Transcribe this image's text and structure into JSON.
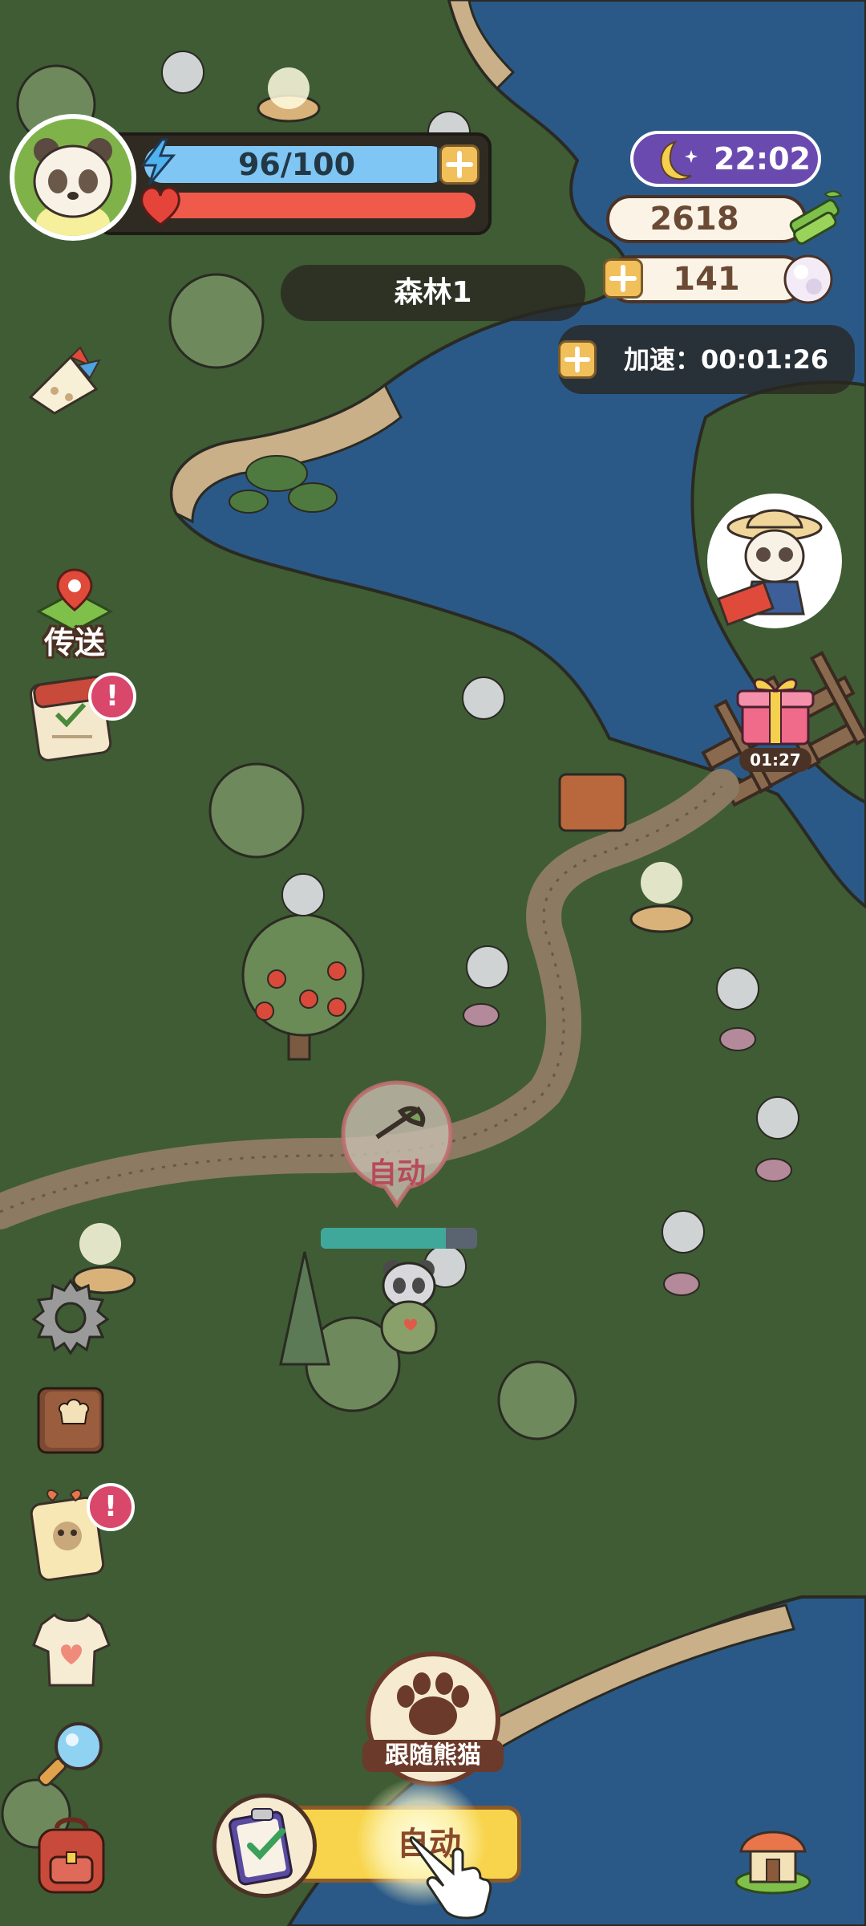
{
  "hud": {
    "energy_text": "96/100",
    "energy_fraction": 0.96,
    "health_fraction": 1.0,
    "location": "森林1",
    "time": "22:02",
    "bamboo": "2618",
    "pearls": "141",
    "speed_label": "加速：00:01:26"
  },
  "side_menu": {
    "teleport_label": "传送"
  },
  "gift": {
    "timer": "01:27"
  },
  "center": {
    "auto_label": "自动",
    "progress_fraction": 0.8
  },
  "bottom": {
    "follow_label": "跟随熊猫",
    "action_label": "自动"
  },
  "badges": {
    "alert": "!"
  },
  "colors": {
    "grass": "#3d5a34",
    "water": "#2c5b8c",
    "path": "#8c7a63",
    "energy": "#7fc6f4",
    "health": "#ef5a4b",
    "moon_pill": "#6b4ab0",
    "badge": "#d9476a",
    "action_button": "#f7d44b"
  }
}
